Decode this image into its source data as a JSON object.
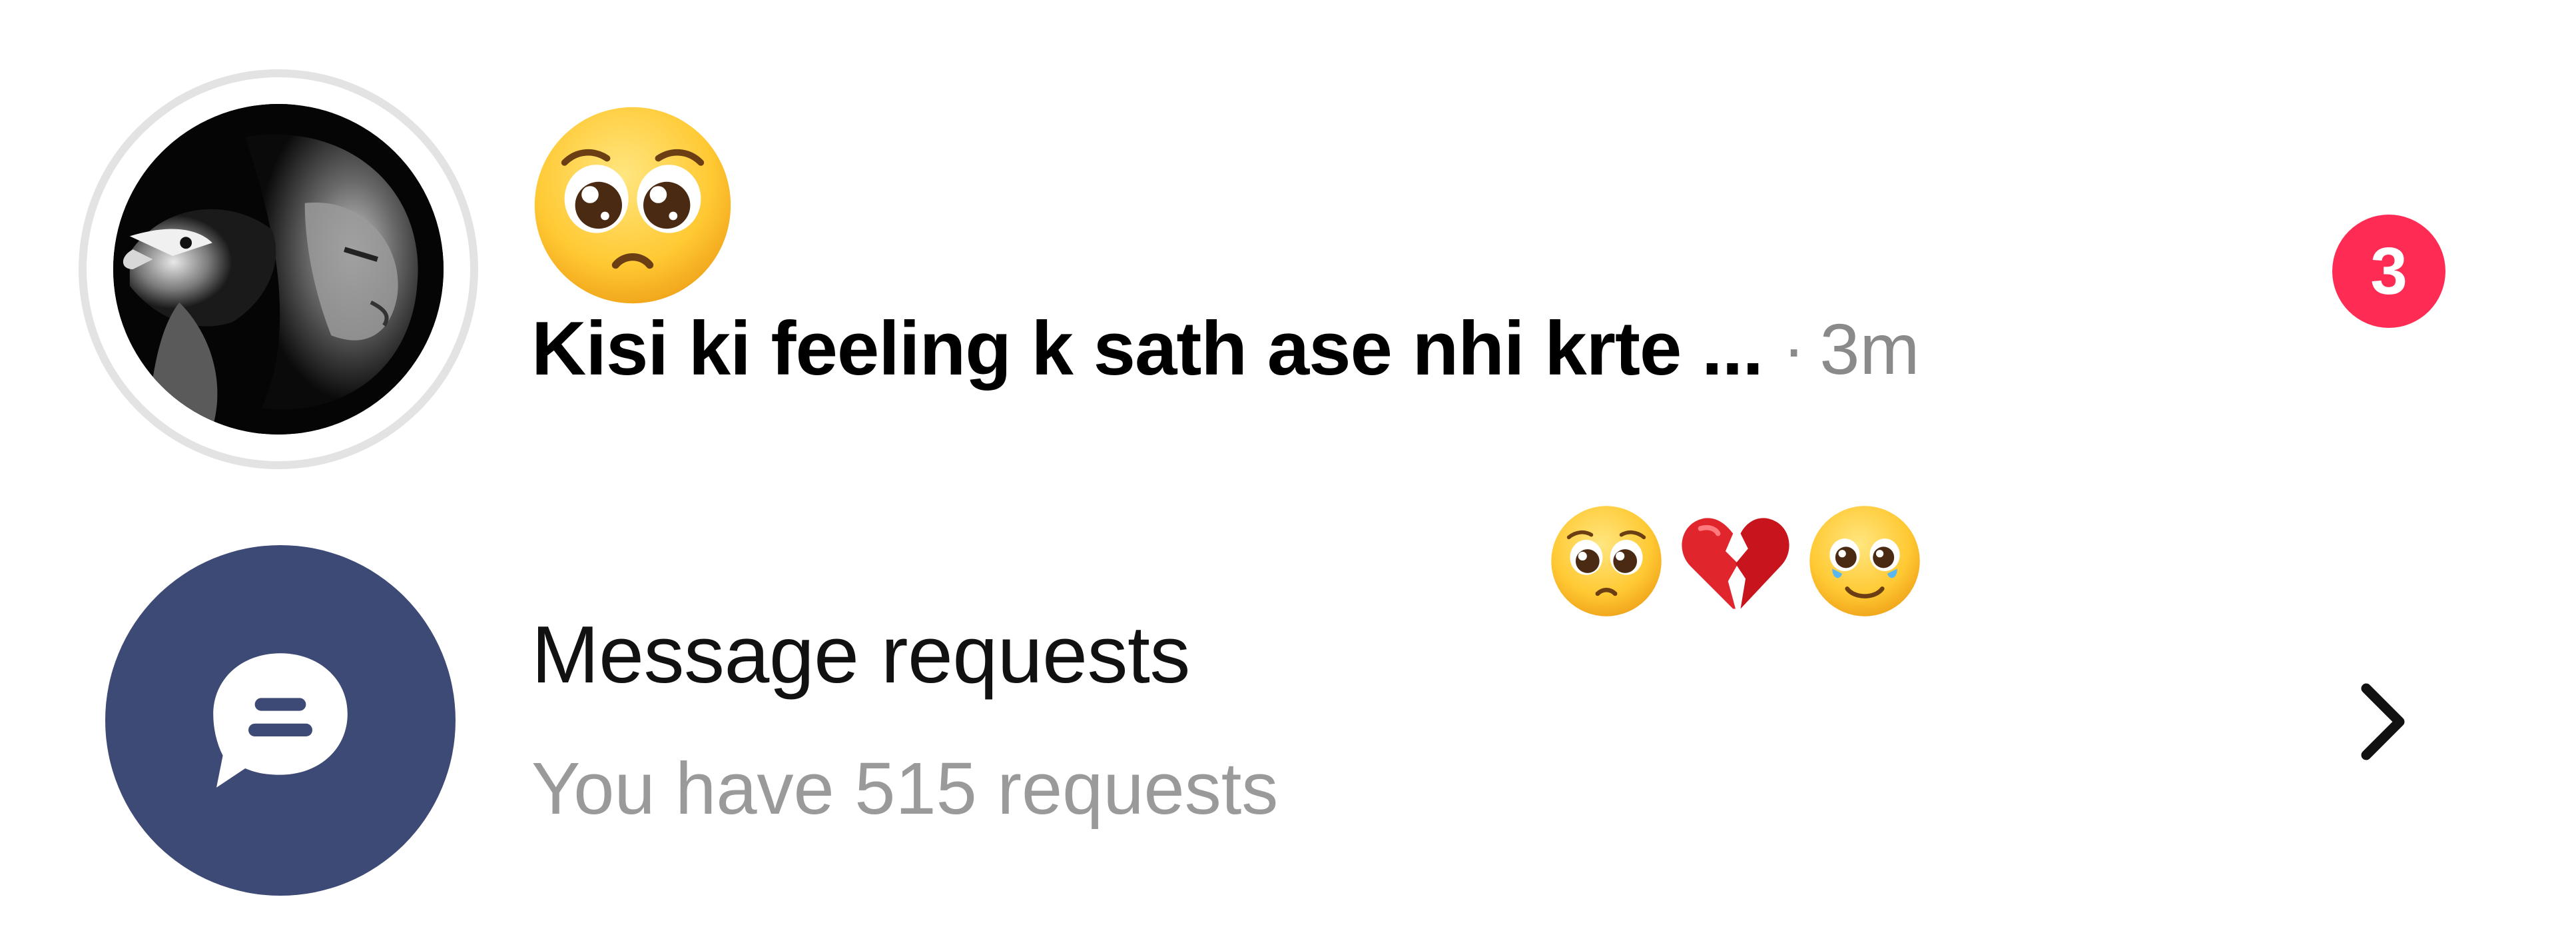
{
  "chat": {
    "preview_text": "Kisi ki feeling k sath ase nhi krte ...",
    "separator": "·",
    "time": "3m",
    "unread_count": "3",
    "avatar_description_icon": "lion-eagle-avatar",
    "header_emoji": "pleading-face-emoji",
    "reaction_emojis": [
      "pleading-face-emoji",
      "broken-heart-emoji",
      "crying-smile-emoji"
    ]
  },
  "requests": {
    "title": "Message requests",
    "subtitle": "You have 515 requests",
    "icon": "chat-bubble-icon",
    "chevron_icon": "chevron-right-icon"
  },
  "colors": {
    "badge": "#fe2c55",
    "requests_avatar_bg": "#3d4a75",
    "secondary_text": "#8a8a8a",
    "ring": "#e3e3e3"
  }
}
